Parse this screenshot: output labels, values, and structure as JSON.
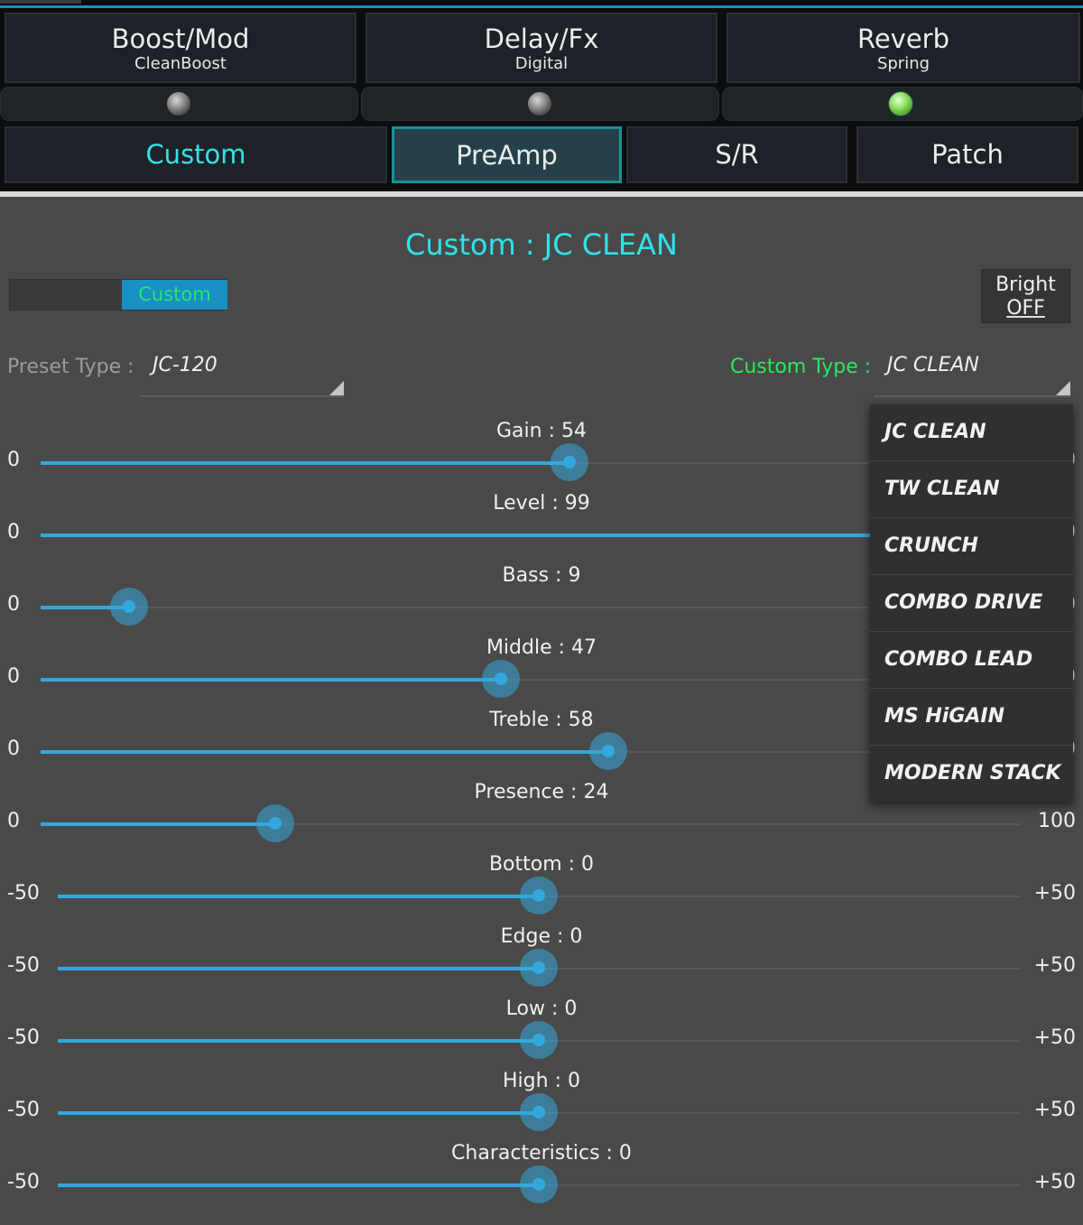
{
  "effects": [
    {
      "title": "Boost/Mod",
      "sub": "CleanBoost",
      "led": "off"
    },
    {
      "title": "Delay/Fx",
      "sub": "Digital",
      "led": "off"
    },
    {
      "title": "Reverb",
      "sub": "Spring",
      "led": "on"
    }
  ],
  "tabs": [
    {
      "label": "Custom"
    },
    {
      "label": "PreAmp",
      "selected": true
    },
    {
      "label": "S/R"
    },
    {
      "label": "Patch"
    }
  ],
  "panel": {
    "title": "Custom : JC CLEAN",
    "mode_toggle": "Custom",
    "bright_label": "Bright",
    "bright_state": "OFF",
    "preset_type_label": "Preset Type :",
    "preset_type_value": "JC-120",
    "custom_type_label": "Custom Type :",
    "custom_type_value": "JC CLEAN"
  },
  "sliders": [
    {
      "label": "Gain : 54",
      "min": "0",
      "max": "100",
      "value": 54
    },
    {
      "label": "Level : 99",
      "min": "0",
      "max": "100",
      "value": 99
    },
    {
      "label": "Bass : 9",
      "min": "0",
      "max": "100",
      "value": 9
    },
    {
      "label": "Middle : 47",
      "min": "0",
      "max": "100",
      "value": 47
    },
    {
      "label": "Treble : 58",
      "min": "0",
      "max": "100",
      "value": 58
    },
    {
      "label": "Presence : 24",
      "min": "0",
      "max": "100",
      "value": 24
    },
    {
      "label": "Bottom : 0",
      "min": "-50",
      "max": "+50",
      "value": 0
    },
    {
      "label": "Edge : 0",
      "min": "-50",
      "max": "+50",
      "value": 0
    },
    {
      "label": "Low : 0",
      "min": "-50",
      "max": "+50",
      "value": 0
    },
    {
      "label": "High : 0",
      "min": "-50",
      "max": "+50",
      "value": 0
    },
    {
      "label": "Characteristics : 0",
      "min": "-50",
      "max": "+50",
      "value": 0
    }
  ],
  "dropdown_options": [
    "JC CLEAN",
    "TW CLEAN",
    "CRUNCH",
    "COMBO DRIVE",
    "COMBO LEAD",
    "MS HiGAIN",
    "MODERN STACK"
  ],
  "colors": {
    "accent": "#33a8dc",
    "title_cyan": "#2fe3ea",
    "green": "#2bea5c"
  }
}
